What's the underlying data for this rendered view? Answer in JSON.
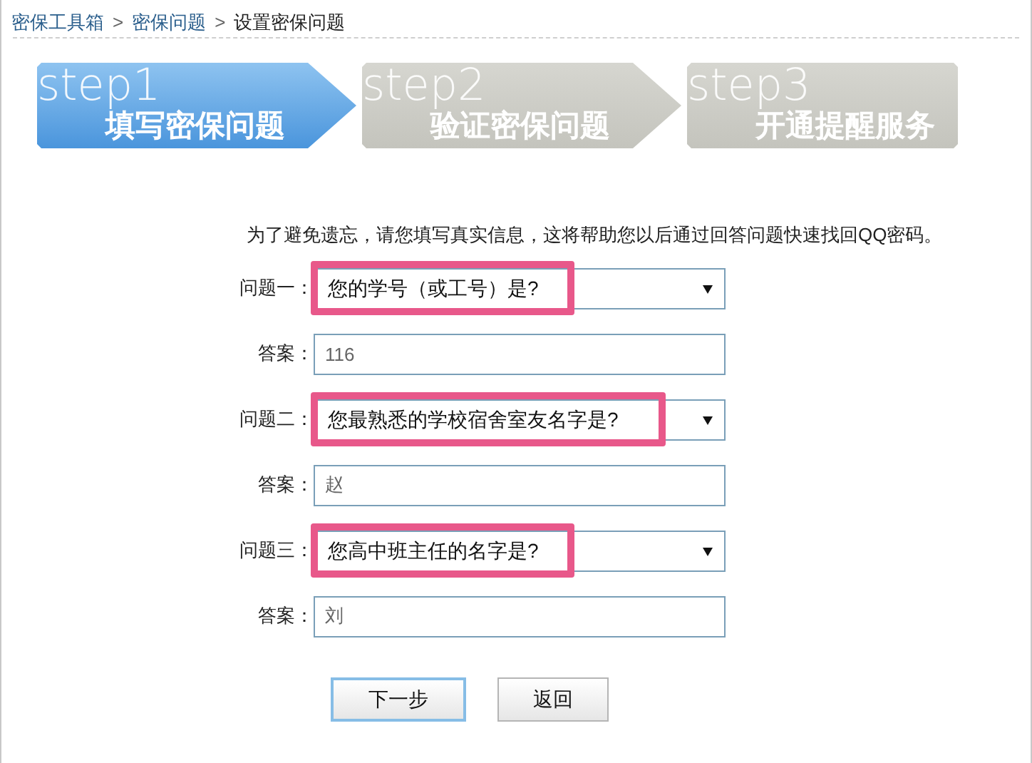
{
  "breadcrumb": [
    "密保工具箱",
    "密保问题",
    "设置密保问题"
  ],
  "breadcrumb_separator": ">",
  "steps": [
    {
      "label": "step1",
      "title": "填写密保问题",
      "selected": true
    },
    {
      "label": "step2",
      "title": "验证密保问题",
      "selected": false
    },
    {
      "label": "step3",
      "title": "开通提醒服务",
      "selected": false
    }
  ],
  "intro": "为了避免遗忘，请您填写真实信息，这将帮助您以后通过回答问题快速找回QQ密码。",
  "questions": [
    {
      "label": "问题一：",
      "value": "您的学号（或工号）是?",
      "highlighted": true,
      "answer_label": "答案：",
      "answer": "116"
    },
    {
      "label": "问题二：",
      "value": "您最熟悉的学校宿舍室友名字是?",
      "highlighted": true,
      "answer_label": "答案：",
      "answer": "赵"
    },
    {
      "label": "问题三：",
      "value": "您高中班主任的名字是?",
      "highlighted": true,
      "answer_label": "答案：",
      "answer": "刘"
    }
  ],
  "buttons": [
    {
      "label": "下一步",
      "primary": true
    },
    {
      "label": "返回",
      "primary": false
    }
  ]
}
